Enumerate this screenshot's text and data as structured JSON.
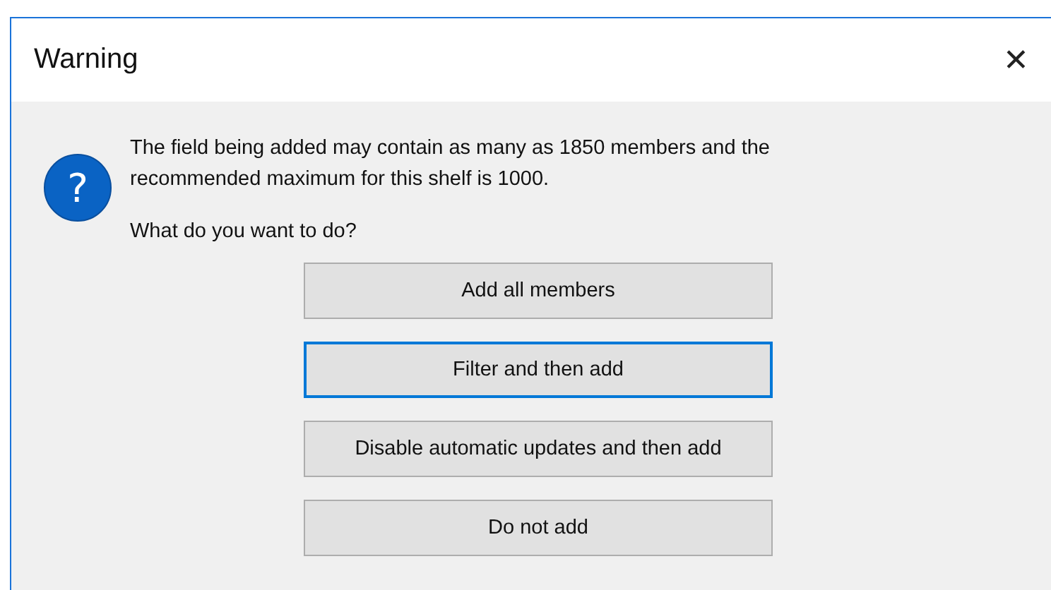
{
  "window": {
    "title": "Warning",
    "close": "✕"
  },
  "message": {
    "lines": [
      "The field being added may contain as many as 1850 members and the",
      "recommended maximum for this shelf is 1000."
    ],
    "question": "What do you want to do?",
    "icon": "?"
  },
  "buttons": [
    {
      "label": "Add all members",
      "focused": false
    },
    {
      "label": "Filter and then add",
      "focused": true
    },
    {
      "label": "Disable automatic updates and then add",
      "focused": false
    },
    {
      "label": "Do not add",
      "focused": false
    }
  ]
}
